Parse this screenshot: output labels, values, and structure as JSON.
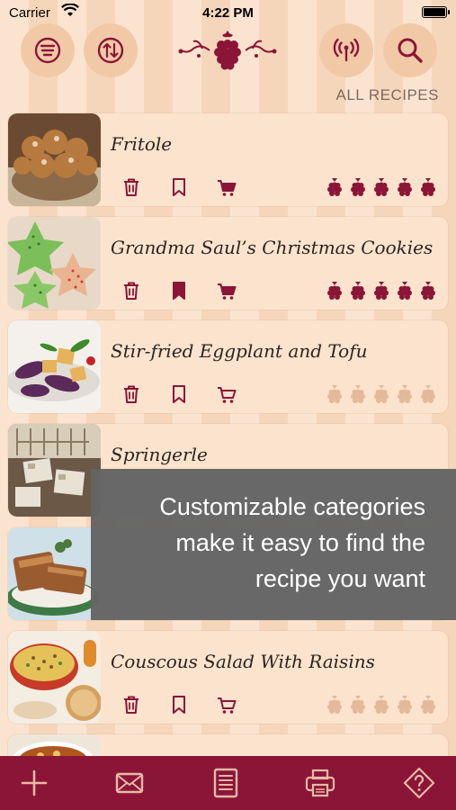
{
  "status_bar": {
    "carrier": "Carrier",
    "time": "4:22 PM"
  },
  "header": {
    "buttons": [
      "filter-list-icon",
      "sort-icon",
      "broadcast-icon",
      "search-icon"
    ],
    "logo": "raspberry-flourish-logo",
    "category_label": "ALL RECIPES"
  },
  "recipes": [
    {
      "title": "Fritole",
      "bookmarked": false,
      "in_cart": true,
      "rating": 5
    },
    {
      "title": "Grandma Saul’s Christmas Cookies",
      "bookmarked": true,
      "in_cart": true,
      "rating": 5
    },
    {
      "title": "Stir-fried Eggplant and Tofu",
      "bookmarked": false,
      "in_cart": false,
      "rating": 0
    },
    {
      "title": "Springerle",
      "bookmarked": false,
      "in_cart": false,
      "rating": 0
    },
    {
      "title": "",
      "bookmarked": false,
      "in_cart": false,
      "rating": 0
    },
    {
      "title": "Couscous Salad With Raisins",
      "bookmarked": false,
      "in_cart": false,
      "rating": 0
    }
  ],
  "overlay": {
    "line1": "Customizable categories",
    "line2": "make it easy to find the",
    "line3": "recipe you want"
  },
  "tabbar": {
    "items": [
      "add-icon",
      "mail-icon",
      "notebook-icon",
      "print-icon",
      "help-icon"
    ]
  },
  "colors": {
    "accent": "#8b1537",
    "background": "#f8dcc3",
    "card": "#fbe3cd",
    "rating_empty": "#e3b99a"
  }
}
